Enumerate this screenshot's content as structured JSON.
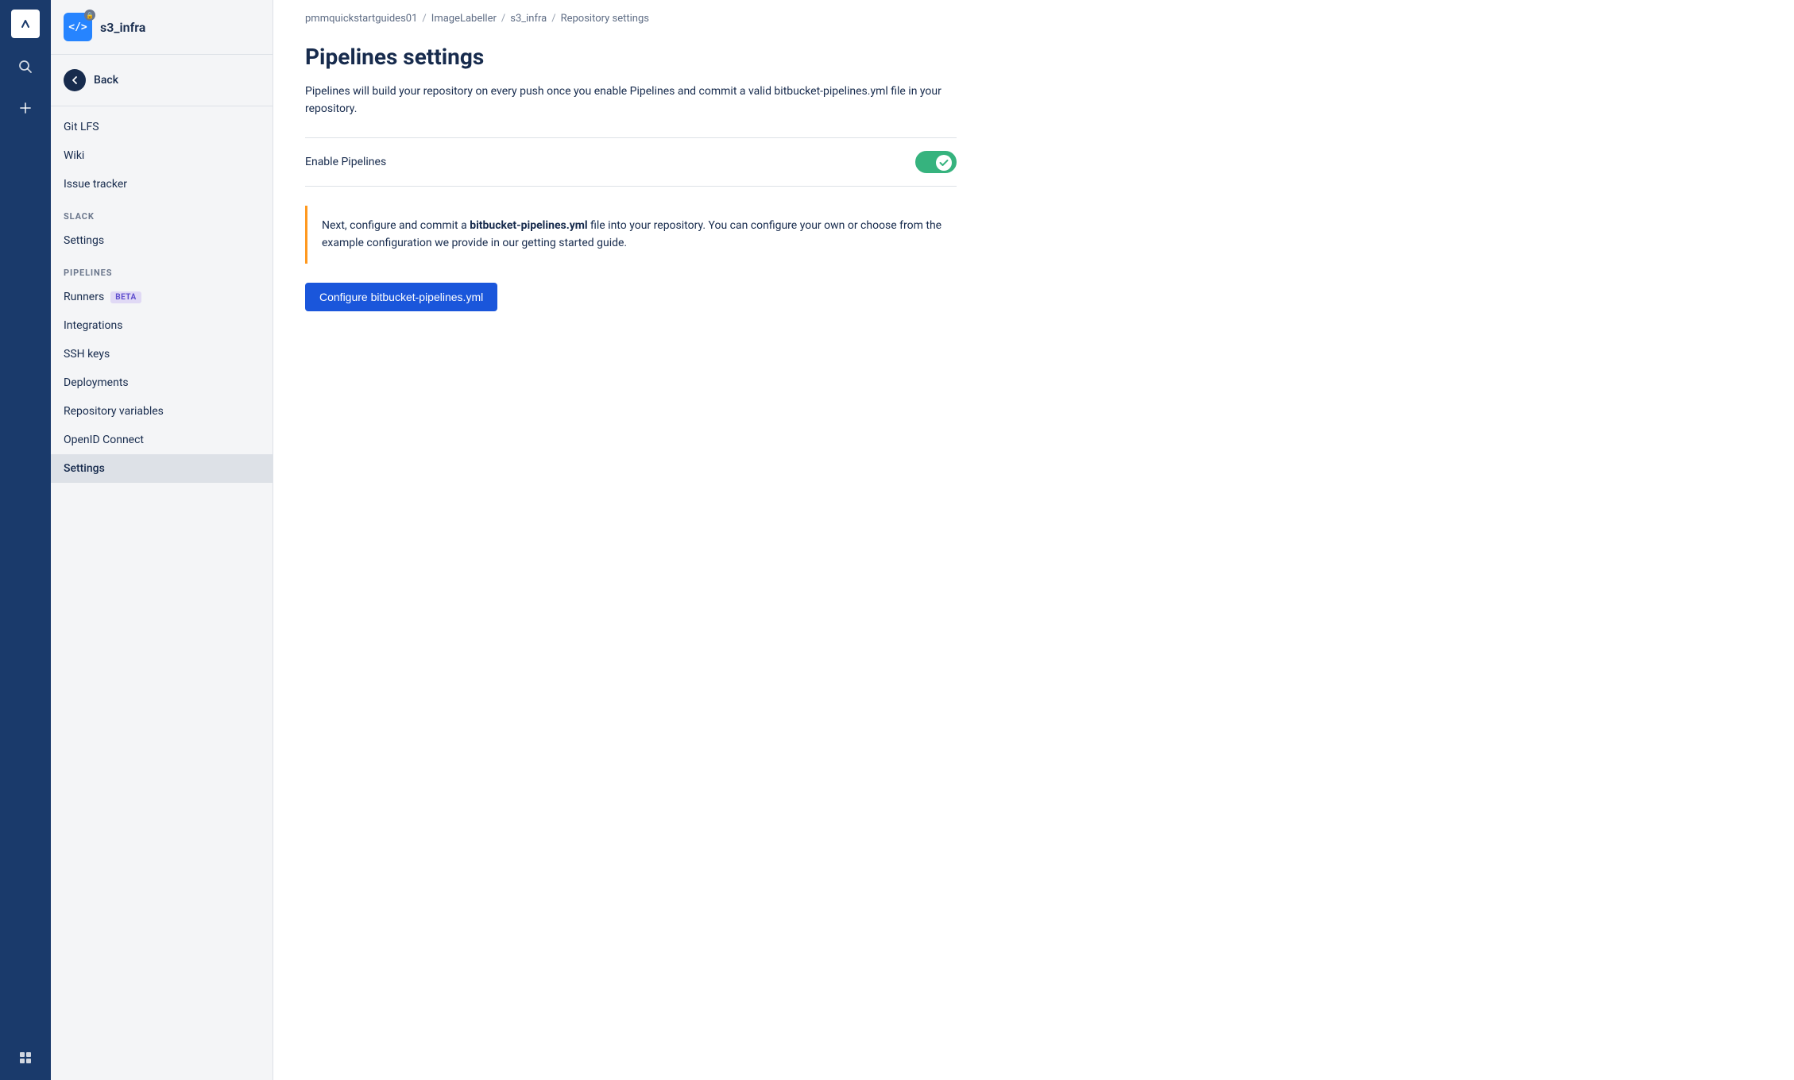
{
  "global": {
    "logo_icon": "▣",
    "search_icon": "🔍",
    "add_icon": "＋",
    "grid_icon": "⊞"
  },
  "sidebar": {
    "repo_name": "s3_infra",
    "repo_icon_text": "</>",
    "back_label": "Back",
    "items_top": [
      {
        "id": "git-lfs",
        "label": "Git LFS"
      },
      {
        "id": "wiki",
        "label": "Wiki"
      },
      {
        "id": "issue-tracker",
        "label": "Issue tracker"
      }
    ],
    "sections": [
      {
        "id": "slack",
        "label": "SLACK",
        "items": [
          {
            "id": "slack-settings",
            "label": "Settings"
          }
        ]
      },
      {
        "id": "pipelines",
        "label": "PIPELINES",
        "items": [
          {
            "id": "runners",
            "label": "Runners",
            "badge": "BETA"
          },
          {
            "id": "integrations",
            "label": "Integrations"
          },
          {
            "id": "ssh-keys",
            "label": "SSH keys"
          },
          {
            "id": "deployments",
            "label": "Deployments"
          },
          {
            "id": "repository-variables",
            "label": "Repository variables"
          },
          {
            "id": "openid-connect",
            "label": "OpenID Connect"
          },
          {
            "id": "pipelines-settings",
            "label": "Settings",
            "active": true
          }
        ]
      }
    ]
  },
  "breadcrumb": {
    "items": [
      {
        "id": "org",
        "label": "pmmquickstartguides01"
      },
      {
        "id": "repo-parent",
        "label": "ImageLabeller"
      },
      {
        "id": "repo",
        "label": "s3_infra"
      },
      {
        "id": "page",
        "label": "Repository settings"
      }
    ],
    "separator": "/"
  },
  "page": {
    "title": "Pipelines settings",
    "description": "Pipelines will build your repository on every push once you enable Pipelines and commit a valid bitbucket-pipelines.yml file in your repository.",
    "enable_pipelines_label": "Enable Pipelines",
    "toggle_enabled": true,
    "info_text_before": "Next, configure and commit a ",
    "info_text_bold": "bitbucket-pipelines.yml",
    "info_text_after": " file into your repository. You can configure your own or choose from the example configuration we provide in our getting started guide.",
    "configure_button_label": "Configure bitbucket-pipelines.yml"
  }
}
